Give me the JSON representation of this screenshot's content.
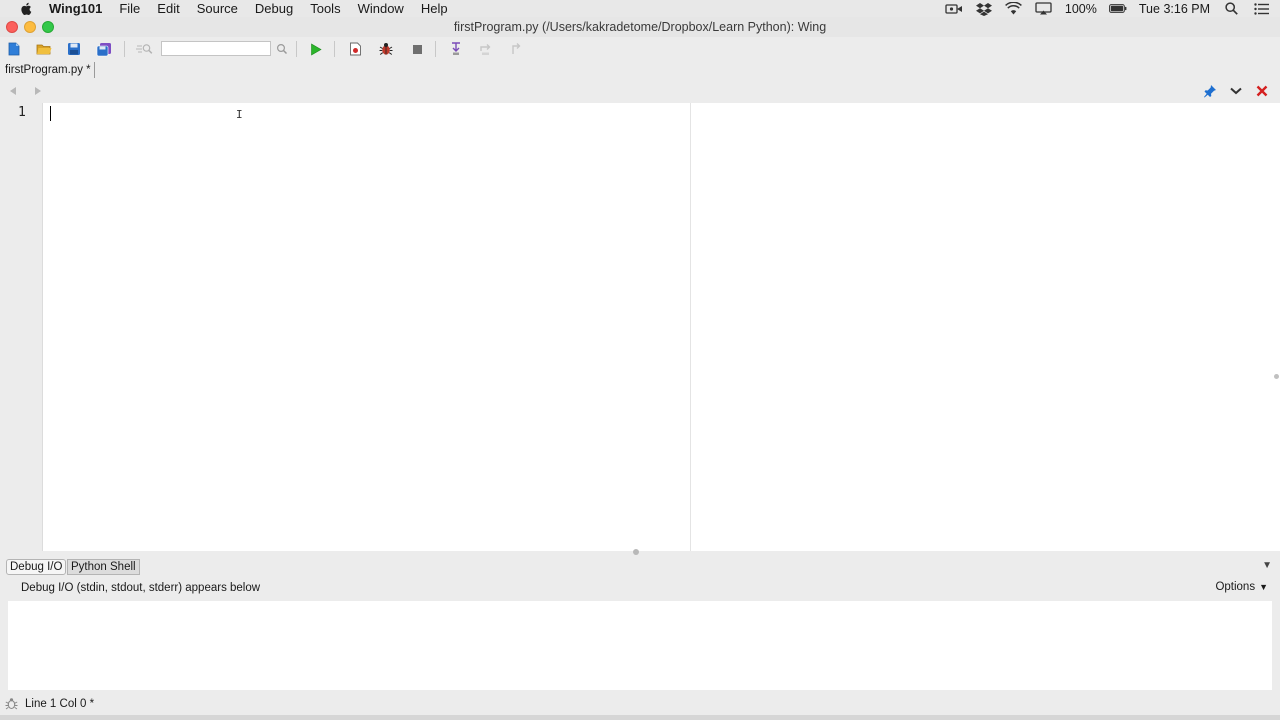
{
  "menubar": {
    "app": "Wing101",
    "items": [
      "File",
      "Edit",
      "Source",
      "Debug",
      "Tools",
      "Window",
      "Help"
    ],
    "battery": "100%",
    "clock": "Tue 3:16 PM"
  },
  "window": {
    "title": "firstProgram.py (/Users/kakradetome/Dropbox/Learn Python): Wing"
  },
  "toolbar": {
    "search_value": ""
  },
  "editor": {
    "tab_label": "firstProgram.py *",
    "line_numbers": [
      "1"
    ],
    "cursor_glyph": "I"
  },
  "panel": {
    "tabs": [
      "Debug I/O",
      "Python Shell"
    ],
    "description": "Debug I/O (stdin, stdout, stderr) appears below",
    "options_label": "Options",
    "arrow": "▼"
  },
  "status": {
    "position": "Line 1 Col 0 *"
  },
  "colors": {
    "run_green": "#2bb52b",
    "close_red": "#d42020",
    "debug_red": "#c0392b"
  }
}
